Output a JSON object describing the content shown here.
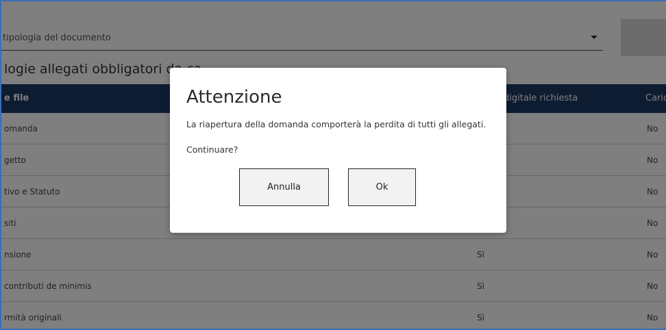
{
  "form": {
    "select_placeholder": "tipologia del documento",
    "section_title": "logie allegati obbligatori da ca"
  },
  "table": {
    "headers": {
      "name": "e file",
      "signature": "digitale richiesta",
      "uploaded": "Caric"
    },
    "rows": [
      {
        "name": "omanda",
        "signature": "",
        "uploaded": "No"
      },
      {
        "name": "getto",
        "signature": "",
        "uploaded": "No"
      },
      {
        "name": "tivo e Statuto",
        "signature": "",
        "uploaded": "No"
      },
      {
        "name": "siti",
        "signature": "",
        "uploaded": "No"
      },
      {
        "name": "nsione",
        "signature": "Sì",
        "uploaded": "No"
      },
      {
        "name": "contributi de minimis",
        "signature": "Sì",
        "uploaded": "No"
      },
      {
        "name": "rmità originali",
        "signature": "Sì",
        "uploaded": "No"
      }
    ]
  },
  "modal": {
    "title": "Attenzione",
    "message": "La riapertura della domanda comporterà la perdita di tutti gli allegati.",
    "question": "Continuare?",
    "cancel_label": "Annulla",
    "ok_label": "Ok"
  },
  "colors": {
    "table_header": "#1c3964",
    "overlay": "rgba(0,0,0,0.5)",
    "frame_border": "#3b6fb6"
  }
}
